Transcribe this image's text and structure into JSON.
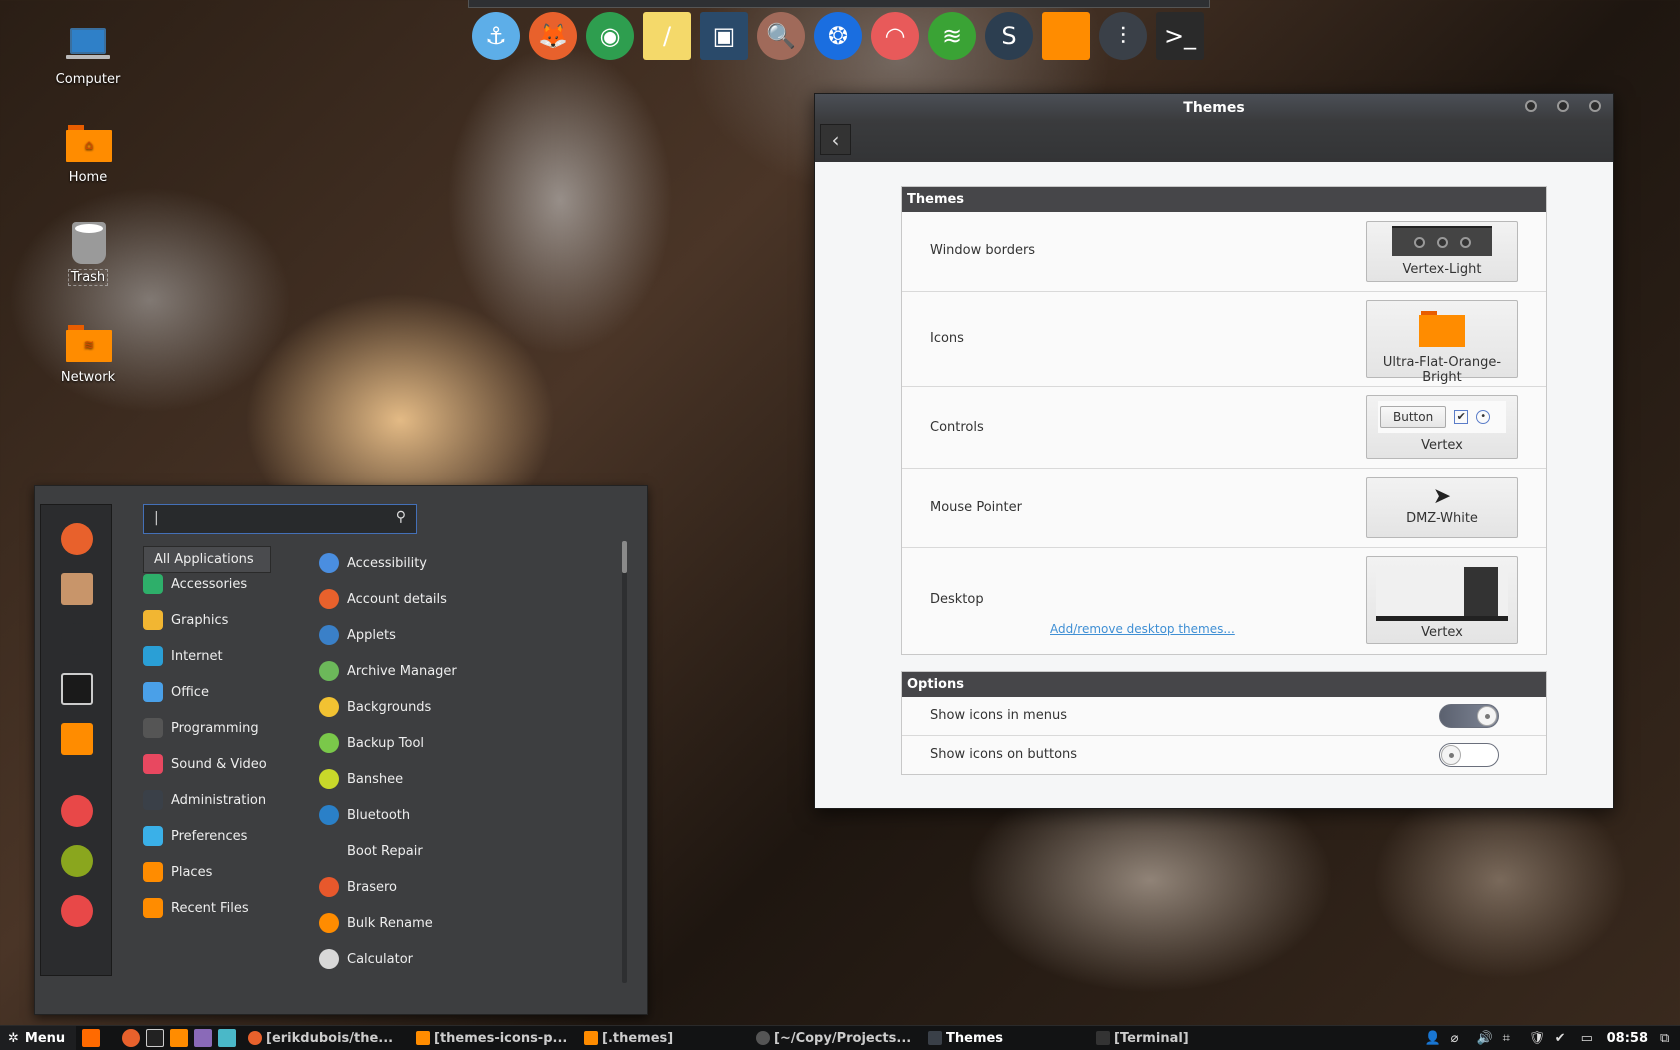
{
  "desktop": {
    "icons": [
      {
        "label": "Computer",
        "icon": "laptop-icon"
      },
      {
        "label": "Home",
        "icon": "home-folder-icon"
      },
      {
        "label": "Trash",
        "icon": "trash-icon"
      },
      {
        "label": "Network",
        "icon": "network-folder-icon"
      }
    ]
  },
  "dock": {
    "items": [
      {
        "name": "anchor",
        "icon": "anchor-icon",
        "glyph": "⚓",
        "color": "#5daee8"
      },
      {
        "name": "firefox",
        "icon": "firefox-icon",
        "glyph": "🦊",
        "color": "#e8612c"
      },
      {
        "name": "chrome",
        "icon": "chrome-icon",
        "glyph": "◉",
        "color": "#2e9e4f"
      },
      {
        "name": "notes",
        "icon": "notes-icon",
        "glyph": "/",
        "color": "#f4d96a"
      },
      {
        "name": "video",
        "icon": "video-icon",
        "glyph": "▣",
        "color": "#2a4a6a"
      },
      {
        "name": "image-viewer",
        "icon": "image-viewer-icon",
        "glyph": "🔍",
        "color": "#a06a5a"
      },
      {
        "name": "aperture",
        "icon": "aperture-icon",
        "glyph": "❂",
        "color": "#1a6ee0"
      },
      {
        "name": "rainbow",
        "icon": "rainbow-icon",
        "glyph": "◠",
        "color": "#e85a5a"
      },
      {
        "name": "spotify",
        "icon": "spotify-icon",
        "glyph": "≋",
        "color": "#3aa335"
      },
      {
        "name": "sublime",
        "icon": "sublime-icon",
        "glyph": "S",
        "color": "#2c3e50"
      },
      {
        "name": "files",
        "icon": "folder-icon",
        "glyph": "",
        "color": "#ff8c00"
      },
      {
        "name": "settings",
        "icon": "sliders-icon",
        "glyph": "⫶",
        "color": "#3a4048"
      },
      {
        "name": "terminal",
        "icon": "terminal-icon",
        "glyph": ">_",
        "color": "#2a2a2a"
      }
    ]
  },
  "themes_window": {
    "title": "Themes",
    "themes_section": {
      "header": "Themes",
      "rows": [
        {
          "label": "Window borders",
          "value": "Vertex-Light"
        },
        {
          "label": "Icons",
          "value": "Ultra-Flat-Orange-Bright"
        },
        {
          "label": "Controls",
          "value": "Vertex",
          "preview_button": "Button"
        },
        {
          "label": "Mouse Pointer",
          "value": "DMZ-White"
        },
        {
          "label": "Desktop",
          "value": "Vertex",
          "link": "Add/remove desktop themes..."
        }
      ]
    },
    "options_section": {
      "header": "Options",
      "rows": [
        {
          "label": "Show icons in menus",
          "enabled": true
        },
        {
          "label": "Show icons on buttons",
          "enabled": false
        }
      ]
    }
  },
  "menu": {
    "search": {
      "value": "|",
      "placeholder": ""
    },
    "favorites": [
      {
        "name": "firefox",
        "icon": "firefox-icon",
        "color": "#e8612c"
      },
      {
        "name": "installer",
        "icon": "package-icon",
        "color": "#c8956a"
      },
      {
        "name": "settings",
        "icon": "sliders-icon",
        "color": "#2b2c2e"
      },
      {
        "name": "terminal",
        "icon": "terminal-icon",
        "color": "#1a1a1a"
      },
      {
        "name": "files",
        "icon": "folder-icon",
        "color": "#ff8c00"
      },
      {
        "name": "lock-screen",
        "icon": "lock-icon",
        "color": "#e84848"
      },
      {
        "name": "logout",
        "icon": "logout-icon",
        "color": "#8aa61e"
      },
      {
        "name": "shutdown",
        "icon": "power-icon",
        "color": "#e84848"
      }
    ],
    "categories": [
      {
        "label": "All Applications",
        "color": ""
      },
      {
        "label": "Accessories",
        "color": "#2eaf6a"
      },
      {
        "label": "Graphics",
        "color": "#f2b632"
      },
      {
        "label": "Internet",
        "color": "#2a9fd6"
      },
      {
        "label": "Office",
        "color": "#4aa0e8"
      },
      {
        "label": "Programming",
        "color": "#555"
      },
      {
        "label": "Sound & Video",
        "color": "#e84860"
      },
      {
        "label": "Administration",
        "color": "#3a4048"
      },
      {
        "label": "Preferences",
        "color": "#3ab0e8"
      },
      {
        "label": "Places",
        "color": "#ff8c00"
      },
      {
        "label": "Recent Files",
        "color": "#ff8c00"
      }
    ],
    "apps": [
      {
        "label": "Accessibility",
        "color": "#4a8ee0"
      },
      {
        "label": "Account details",
        "color": "#e8612c"
      },
      {
        "label": "Applets",
        "color": "#3a80c8"
      },
      {
        "label": "Archive Manager",
        "color": "#6cb85a"
      },
      {
        "label": "Backgrounds",
        "color": "#f2c232"
      },
      {
        "label": "Backup Tool",
        "color": "#7ac84a"
      },
      {
        "label": "Banshee",
        "color": "#c8d82a"
      },
      {
        "label": "Bluetooth",
        "color": "#2a80c8"
      },
      {
        "label": "Boot Repair",
        "color": ""
      },
      {
        "label": "Brasero",
        "color": "#e8582c"
      },
      {
        "label": "Bulk Rename",
        "color": "#ff8c00"
      },
      {
        "label": "Calculator",
        "color": "#d8d8d8"
      }
    ]
  },
  "panel": {
    "menu_label": "Menu",
    "launchers": [
      {
        "icon": "files-icon",
        "color": "#ff6a00"
      },
      {
        "icon": "firefox-icon",
        "color": "#e8612c"
      },
      {
        "icon": "terminal-icon",
        "color": "#222"
      },
      {
        "icon": "folder-icon",
        "color": "#ff8c00"
      },
      {
        "icon": "video-icon",
        "color": "#8a6ab8"
      },
      {
        "icon": "photos-icon",
        "color": "#4ab8c8"
      }
    ],
    "tasks": [
      {
        "label": "[erikdubois/the...",
        "icon": "firefox-icon",
        "color": "#e8612c",
        "active": false
      },
      {
        "label": "[themes-icons-p...",
        "icon": "folder-icon",
        "color": "#ff8c00",
        "active": false
      },
      {
        "label": "[.themes]",
        "icon": "folder-icon",
        "color": "#ff8c00",
        "active": false
      },
      {
        "label": "[~/Copy/Projects...",
        "icon": "sublime-icon",
        "color": "#555",
        "active": false
      },
      {
        "label": "Themes",
        "icon": "sliders-icon",
        "color": "#3a4048",
        "active": true
      },
      {
        "label": "[Terminal]",
        "icon": "terminal-icon",
        "color": "#333",
        "active": false
      }
    ],
    "tray": [
      {
        "icon": "user-icon",
        "glyph": "👤"
      },
      {
        "icon": "network-icon",
        "glyph": "⌀"
      },
      {
        "icon": "volume-icon",
        "glyph": "🔊"
      },
      {
        "icon": "screenshot-icon",
        "glyph": "⌗"
      },
      {
        "icon": "shield-icon",
        "glyph": "🛡"
      },
      {
        "icon": "update-icon",
        "glyph": "✔"
      },
      {
        "icon": "display-icon",
        "glyph": "▭"
      }
    ],
    "clock": "08:58",
    "show_desktop_icon": "show-desktop-icon"
  }
}
